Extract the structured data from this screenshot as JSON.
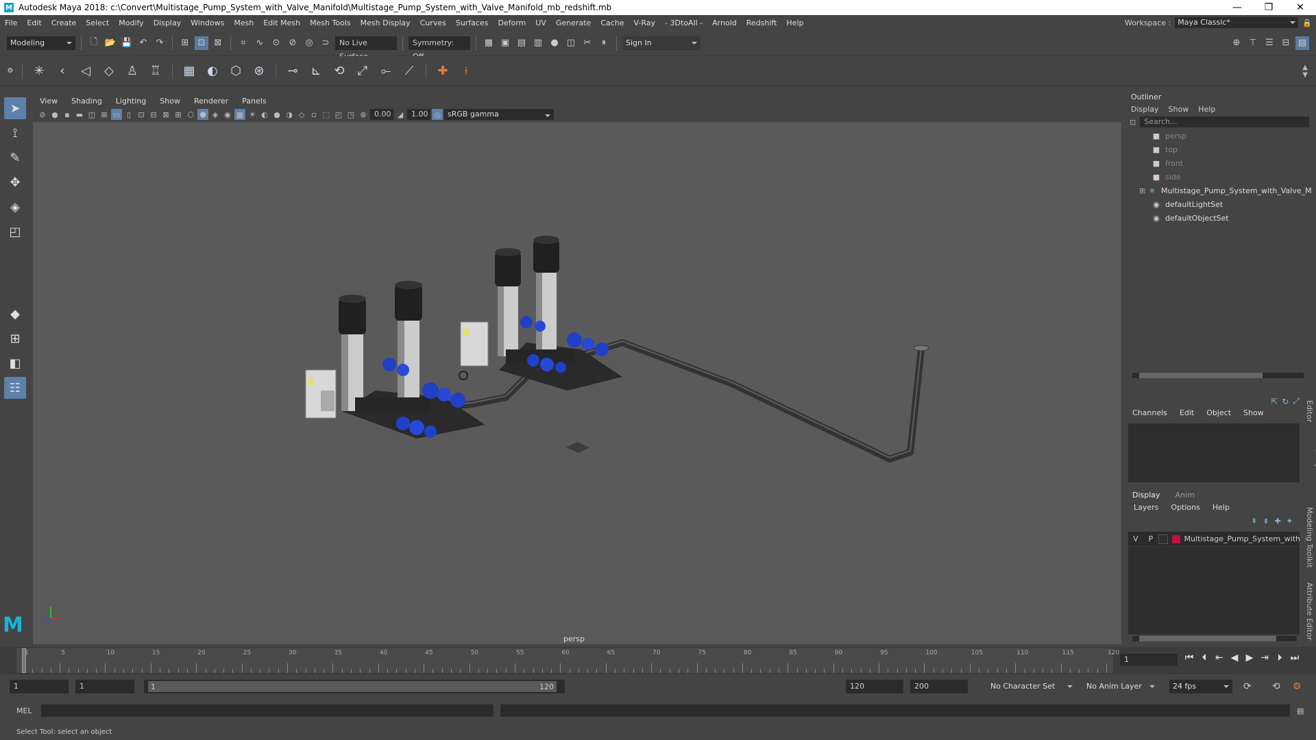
{
  "titlebar": {
    "title": "Autodesk Maya 2018: c:\\Convert\\Multistage_Pump_System_with_Valve_Manifold\\Multistage_Pump_System_with_Valve_Manifold_mb_redshift.mb",
    "logo": "M",
    "minimize": "—",
    "maximize": "❐",
    "close": "✕"
  },
  "menubar": {
    "items": [
      "File",
      "Edit",
      "Create",
      "Select",
      "Modify",
      "Display",
      "Windows",
      "Mesh",
      "Edit Mesh",
      "Mesh Tools",
      "Mesh Display",
      "Curves",
      "Surfaces",
      "Deform",
      "UV",
      "Generate",
      "Cache",
      "V-Ray",
      "- 3DtoAll -",
      "Arnold",
      "Redshift",
      "Help"
    ],
    "workspace_label": "Workspace :",
    "workspace_value": "Maya Classic*"
  },
  "statusline": {
    "mode": "Modeling",
    "live_surface": "No Live Surface",
    "symmetry": "Symmetry: Off",
    "sign_in": "Sign In"
  },
  "viewport": {
    "menu": [
      "View",
      "Shading",
      "Lighting",
      "Show",
      "Renderer",
      "Panels"
    ],
    "exposure": "0.00",
    "gamma": "1.00",
    "color_space": "sRGB gamma",
    "camera_label": "persp"
  },
  "outliner": {
    "title": "Outliner",
    "menu": [
      "Display",
      "Show",
      "Help"
    ],
    "search_placeholder": "Search...",
    "items": [
      {
        "label": "persp",
        "icon": "camera-icon",
        "dim": true
      },
      {
        "label": "top",
        "icon": "camera-icon",
        "dim": true
      },
      {
        "label": "front",
        "icon": "camera-icon",
        "dim": true
      },
      {
        "label": "side",
        "icon": "camera-icon",
        "dim": true
      },
      {
        "label": "Multistage_Pump_System_with_Valve_M",
        "icon": "group-icon",
        "dim": false
      },
      {
        "label": "defaultLightSet",
        "icon": "set-icon",
        "dim": false
      },
      {
        "label": "defaultObjectSet",
        "icon": "set-icon",
        "dim": false
      }
    ]
  },
  "channelbox": {
    "menu": [
      "Channels",
      "Edit",
      "Object",
      "Show"
    ],
    "side_tab": "Channel Box / Layer Editor"
  },
  "layereditor": {
    "tabs": [
      "Display",
      "Anim"
    ],
    "menu": [
      "Layers",
      "Options",
      "Help"
    ],
    "layer": {
      "v": "V",
      "p": "P",
      "name": "Multistage_Pump_System_with",
      "color": "#c0123a"
    },
    "side_tabs": [
      "Modeling Toolkit",
      "Attribute Editor"
    ]
  },
  "timeline": {
    "ticks": [
      "1",
      "5",
      "10",
      "15",
      "20",
      "25",
      "30",
      "35",
      "40",
      "45",
      "50",
      "55",
      "60",
      "65",
      "70",
      "75",
      "80",
      "85",
      "90",
      "95",
      "100",
      "105",
      "110",
      "115",
      "120"
    ],
    "current_frame": "1"
  },
  "rangebar": {
    "start": "1",
    "playback_start": "1",
    "slider_start": "1",
    "slider_end": "120",
    "playback_end": "120",
    "end": "200",
    "character_set": "No Character Set",
    "anim_layer": "No Anim Layer",
    "fps": "24 fps"
  },
  "cmdline": {
    "label": "MEL"
  },
  "helpline": {
    "text": "Select Tool: select an object"
  },
  "colors": {
    "accent": "#5d81a8",
    "valve_blue": "#2040c8",
    "bg": "#444444"
  }
}
